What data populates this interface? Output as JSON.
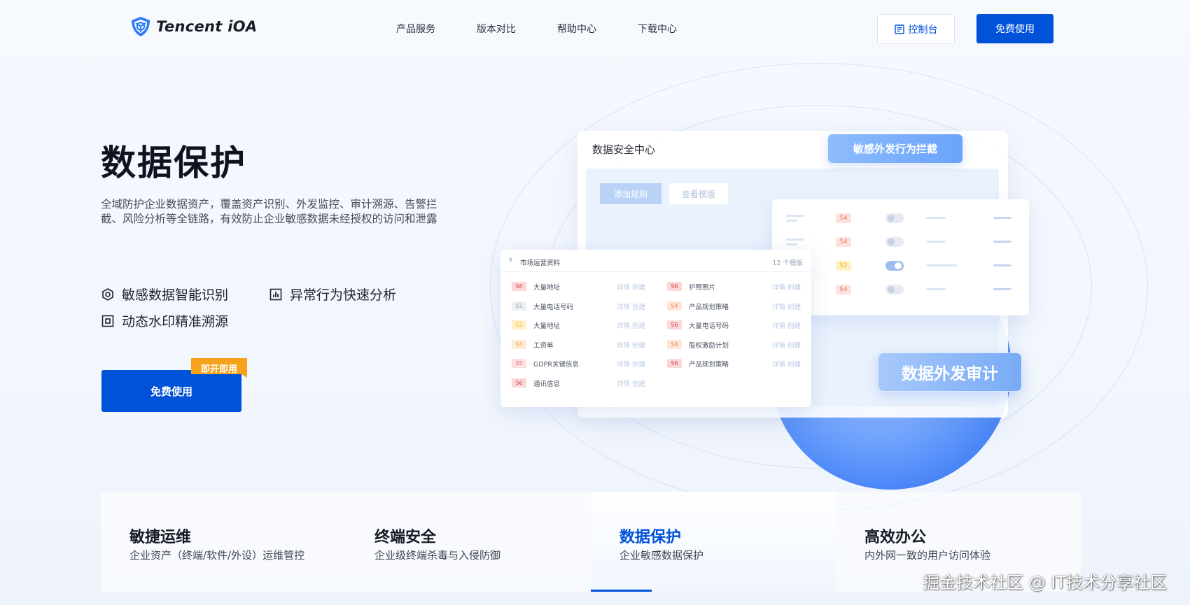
{
  "brand": {
    "name": "Tencent iOA"
  },
  "nav": {
    "items": [
      "产品服务",
      "版本对比",
      "帮助中心",
      "下载中心"
    ]
  },
  "header": {
    "console_label": "控制台",
    "free_label": "免费使用"
  },
  "hero": {
    "title": "数据保护",
    "description": "全域防护企业数据资产，覆盖资产识别、外发监控、审计溯源、告警拦截、风险分析等全链路，有效防止企业敏感数据未经授权的访问和泄露",
    "features": [
      "敏感数据智能识别",
      "异常行为快速分析",
      "动态水印精准溯源"
    ],
    "cta_label": "免费使用",
    "cta_badge": "即开即用"
  },
  "illustration": {
    "panel_title": "数据安全中心",
    "add_rule": "添加规则",
    "view_template": "查看模版",
    "tag_intercept": "敏感外发行为拦截",
    "tag_audit": "数据外发审计",
    "table_rows": [
      {
        "severity": "S4",
        "enabled": false
      },
      {
        "severity": "S4",
        "enabled": false
      },
      {
        "severity": "S2",
        "enabled": true
      },
      {
        "severity": "S4",
        "enabled": false
      }
    ],
    "list": {
      "title": "市场运营资料",
      "count": "12 个模版",
      "action": "详情  创建",
      "items": [
        {
          "severity": "S6",
          "name": "大量地址"
        },
        {
          "severity": "S6",
          "name": "护照照片"
        },
        {
          "severity": "S1",
          "name": "大量电话号码"
        },
        {
          "severity": "S4",
          "name": "产品规划策略"
        },
        {
          "severity": "S2",
          "name": "大量地址"
        },
        {
          "severity": "S6",
          "name": "大量电话号码"
        },
        {
          "severity": "S3",
          "name": "工资单"
        },
        {
          "severity": "S4",
          "name": "股权激励计划"
        },
        {
          "severity": "S5",
          "name": "GDPR关键信息"
        },
        {
          "severity": "S6",
          "name": "产品规划策略"
        },
        {
          "severity": "S6",
          "name": "通讯信息"
        }
      ]
    }
  },
  "solutions": [
    {
      "title": "敏捷运维",
      "subtitle": "企业资产（终端/软件/外设）运维管控",
      "active": false
    },
    {
      "title": "终端安全",
      "subtitle": "企业级终端杀毒与入侵防御",
      "active": false
    },
    {
      "title": "数据保护",
      "subtitle": "企业敏感数据保护",
      "active": true
    },
    {
      "title": "高效办公",
      "subtitle": "内外网一致的用户访问体验",
      "active": false
    }
  ],
  "watermark": "掘金技术社区 @ IT技术分享社区",
  "colors": {
    "primary": "#0052d9",
    "badge": "#f7a21b"
  }
}
